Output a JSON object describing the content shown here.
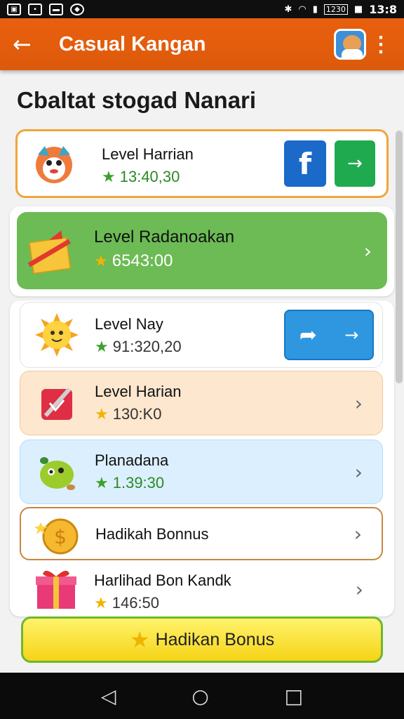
{
  "status": {
    "time": "13:8",
    "battery": "1230"
  },
  "appbar": {
    "back_icon": "arrow-left-icon",
    "title": "Casual Kangan",
    "menu_icon": "kebab-menu-icon"
  },
  "heading": "Cbaltat stogad Nanari",
  "items": [
    {
      "title": "Level Harrian",
      "value": "13:40,30",
      "icon": "fox-mascot-icon",
      "star": "green-star"
    },
    {
      "title": "Level Radanoakan",
      "value": "6543:00",
      "icon": "gift-box-icon",
      "star": "gold-star"
    },
    {
      "title": "Level Nay",
      "value": "91:320,20",
      "icon": "sun-character-icon",
      "star": "green-star"
    },
    {
      "title": "Level Harian",
      "value": "130:K0",
      "icon": "red-card-icon",
      "star": "gold-star"
    },
    {
      "title": "Planadana",
      "value": "1.39:30",
      "icon": "green-monster-icon",
      "star": "green-star"
    },
    {
      "title": "Hadikah Bonnus",
      "value": "",
      "icon": "gold-coin-icon",
      "star": ""
    },
    {
      "title": "Harlihad Bon Kandk",
      "value": "146:50",
      "icon": "red-gift-icon",
      "star": "gold-star"
    }
  ],
  "buttons": {
    "facebook": "f",
    "go": "→",
    "share": "→"
  },
  "bonus_button": "Hadikan Bonus",
  "colors": {
    "appbar": "#e8600e",
    "highlight_card": "#6cbb55",
    "peach_card": "#fde7cf",
    "blue_card": "#dcefff"
  }
}
